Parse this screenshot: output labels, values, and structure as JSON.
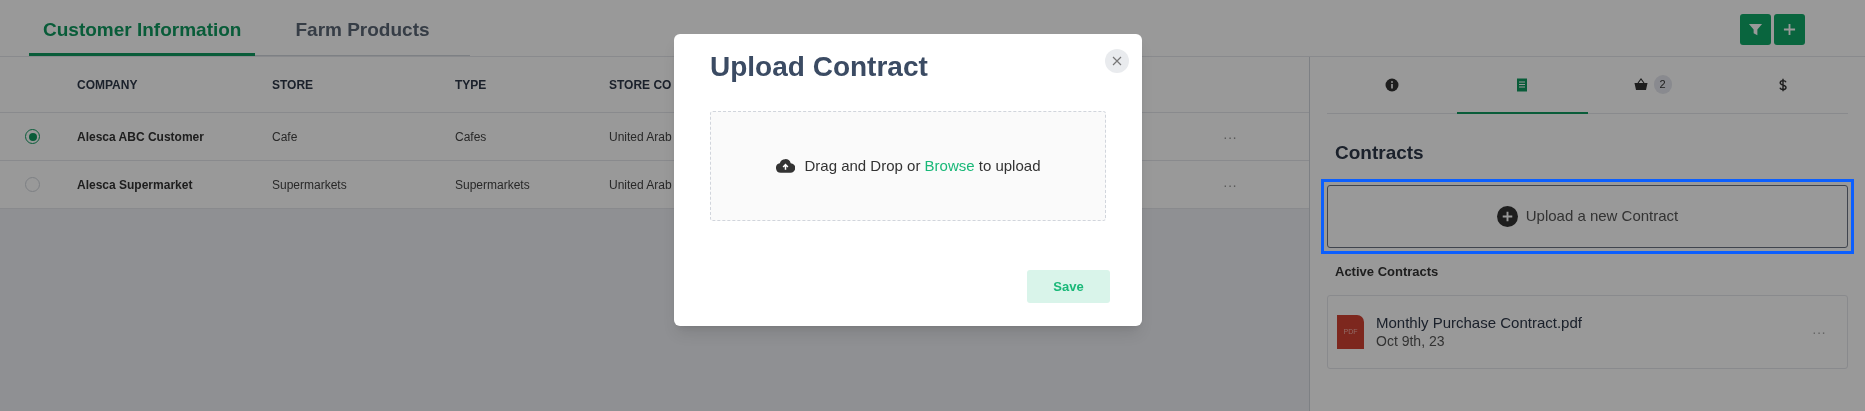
{
  "top_tabs": [
    {
      "label": "Customer Information",
      "selected": true
    },
    {
      "label": "Farm Products",
      "selected": false
    }
  ],
  "table": {
    "columns": [
      "COMPANY",
      "STORE",
      "TYPE",
      "STORE CO"
    ],
    "rows": [
      {
        "selected": true,
        "cells": [
          "Alesca ABC Customer",
          "Cafe",
          "Cafes",
          "United Arab"
        ],
        "menu": "···"
      },
      {
        "selected": false,
        "cells": [
          "Alesca Supermarket",
          "Supermarkets",
          "Supermarkets",
          "United Arab"
        ],
        "menu": "···"
      }
    ]
  },
  "side_panel": {
    "tabs": [
      {
        "kind": "info",
        "selected": false
      },
      {
        "kind": "document",
        "selected": true
      },
      {
        "kind": "basket",
        "selected": false,
        "badge": "2"
      },
      {
        "kind": "dollar",
        "selected": false
      }
    ],
    "title": "Contracts",
    "upload_button": {
      "label": "Upload a new Contract",
      "focused": true
    },
    "active_heading": "Active Contracts",
    "contracts": [
      {
        "name": "Monthly Purchase Contract.pdf",
        "date": "Oct 9th, 23",
        "file_type": "PDF",
        "menu": "···"
      }
    ]
  },
  "modal": {
    "title": "Upload Contract",
    "drop_before": "Drag and Drop or",
    "drop_link": "Browse",
    "drop_after": "to upload",
    "save": "Save"
  }
}
